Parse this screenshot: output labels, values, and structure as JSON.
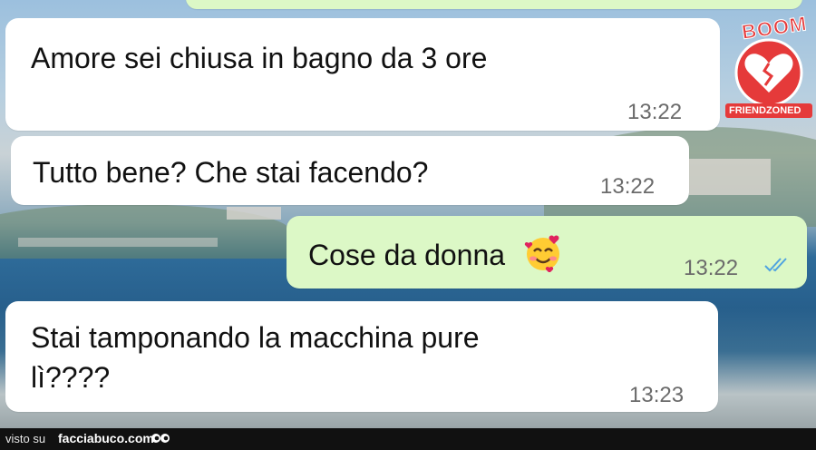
{
  "messages": [
    {
      "direction": "incoming",
      "text": "Amore sei chiusa in bagno da 3 ore",
      "time": "13:22"
    },
    {
      "direction": "incoming",
      "text": "Tutto bene? Che stai facendo?",
      "time": "13:22"
    },
    {
      "direction": "outgoing",
      "text": "Cose da donna",
      "emoji": "smiling-face-with-hearts",
      "time": "13:22",
      "status": "read"
    },
    {
      "direction": "incoming",
      "text_line1": "Stai tamponando la macchina pure",
      "text_line2": "lì????",
      "time": "13:23"
    }
  ],
  "watermark": {
    "top": "BOOM",
    "bottom": "FRIENDZONED"
  },
  "footer": {
    "visto": "visto su",
    "site": "facciabuco.com"
  },
  "colors": {
    "incoming": "#ffffff",
    "outgoing": "#dcf8c6",
    "read_ticks": "#4fa3e0"
  }
}
